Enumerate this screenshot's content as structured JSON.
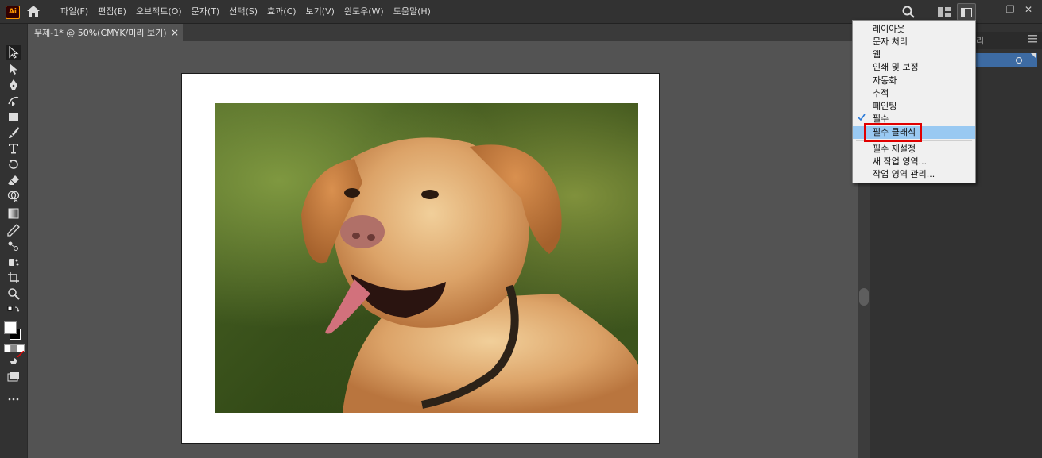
{
  "app": {
    "logo_text": "Ai"
  },
  "menubar": {
    "items": [
      "파일(F)",
      "편집(E)",
      "오브젝트(O)",
      "문자(T)",
      "선택(S)",
      "효과(C)",
      "보기(V)",
      "윈도우(W)",
      "도움말(H)"
    ]
  },
  "window_controls": {
    "minimize": "—",
    "restore": "❐",
    "close": "✕"
  },
  "document": {
    "tab_title": "무제-1* @ 50%(CMYK/미리 보기)",
    "close": "×"
  },
  "panel": {
    "tab_fragment": "리"
  },
  "workspace_menu": {
    "items": [
      {
        "label": "레이아웃",
        "checked": false,
        "highlighted": false
      },
      {
        "label": "문자 처리",
        "checked": false,
        "highlighted": false
      },
      {
        "label": "웹",
        "checked": false,
        "highlighted": false
      },
      {
        "label": "인쇄 및 보정",
        "checked": false,
        "highlighted": false
      },
      {
        "label": "자동화",
        "checked": false,
        "highlighted": false
      },
      {
        "label": "추적",
        "checked": false,
        "highlighted": false
      },
      {
        "label": "페인팅",
        "checked": false,
        "highlighted": false
      },
      {
        "label": "필수",
        "checked": true,
        "highlighted": false
      },
      {
        "label": "필수 클래식",
        "checked": false,
        "highlighted": true
      },
      {
        "label": "필수 재설정",
        "checked": false,
        "highlighted": false
      },
      {
        "label": "새 작업 영역...",
        "checked": false,
        "highlighted": false
      },
      {
        "label": "작업 영역 관리...",
        "checked": false,
        "highlighted": false
      }
    ]
  },
  "colors": {
    "accent_highlight": "#99c9f2",
    "annotation_box": "#e00000",
    "layer_selected": "#3d6ba3"
  }
}
